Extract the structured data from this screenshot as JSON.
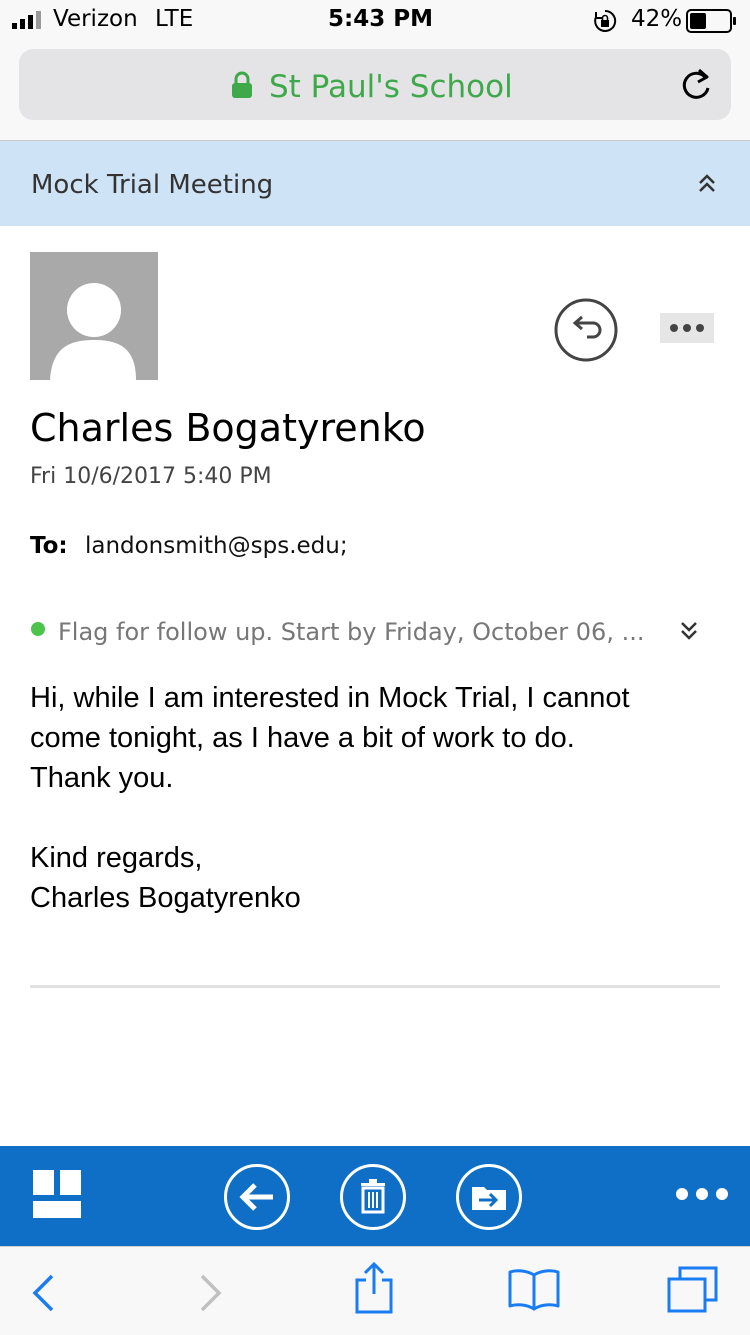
{
  "status_bar": {
    "carrier": "Verizon",
    "network": "LTE",
    "time": "5:43 PM",
    "battery_percent": "42%",
    "battery_level": 0.42
  },
  "browser": {
    "site_title": "St Paul's School",
    "secure_color": "#3fa84a"
  },
  "email": {
    "subject": "Mock Trial Meeting",
    "sender_name": "Charles Bogatyrenko",
    "sent_date": "Fri 10/6/2017 5:40 PM",
    "to_label": "To:",
    "to_value": "landonsmith@sps.edu;",
    "flag_text": "Flag for follow up. Start by Friday, October 06, ...",
    "body_lines": [
      "Hi, while I am interested in Mock Trial, I cannot",
      "come tonight, as I have a bit of work to do.",
      "Thank you."
    ],
    "signoff_lines": [
      "Kind regards,",
      "Charles Bogatyrenko"
    ]
  },
  "toolbar": {
    "color": "#0f6fc6",
    "icons": [
      "app-grid-icon",
      "back-arrow-icon",
      "trash-icon",
      "move-folder-icon",
      "more-icon"
    ]
  },
  "safari_bar": {
    "icons": [
      "back-chevron-icon",
      "forward-chevron-icon",
      "share-icon",
      "bookmarks-icon",
      "tabs-icon"
    ]
  }
}
